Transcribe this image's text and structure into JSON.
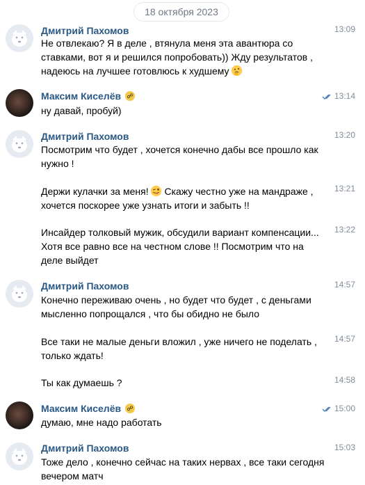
{
  "date_label": "18 октября 2023",
  "messages": [
    {
      "author": "Дмитрий Пахомов",
      "time": "13:09",
      "text": "Не отвлекаю? Я в деле , втянула меня эта авантюра со ставками, вот я и решился попробовать)) Жду результатов , надеюсь на лучшее готовлюсь к худшему",
      "emoji": "thinking-face"
    },
    {
      "author": "Максим Киселёв",
      "time": "13:14",
      "text": "ну давай, пробуй)",
      "read": true
    },
    {
      "author": "Дмитрий Пахомов",
      "time": "13:20",
      "text": "Посмотрим что будет , хочется конечно дабы все прошло как нужно !"
    },
    {
      "time": "13:21",
      "text_a": "Держи кулачки за меня!",
      "text_b": " Скажу честно уже на мандраже , хочется поскорее уже узнать итоги и забыть !!",
      "emoji": "winking-face-with-tongue"
    },
    {
      "time": "13:22",
      "text": "Инсайдер толковый мужик, обсудили вариант компенсации... Хотя все равно все на честном слове !! Посмотрим что на деле выйдет"
    },
    {
      "author": "Дмитрий Пахомов",
      "time": "14:57",
      "text": "Конечно переживаю очень , но будет что будет , с деньгами мысленно попрощался , что бы обидно не было"
    },
    {
      "time": "14:57",
      "text": "Все таки не малые деньги вложил , уже ничего не поделать , только ждать!"
    },
    {
      "time": "14:58",
      "text": "Ты как думаешь ?"
    },
    {
      "author": "Максим Киселёв",
      "time": "15:00",
      "text": "думаю, мне надо работать",
      "read": true
    },
    {
      "author": "Дмитрий Пахомов",
      "time": "15:03",
      "text": "Тоже дело , конечно сейчас на таких нервах , все таки сегодня вечером матч"
    }
  ],
  "colors": {
    "author": "#2a5885",
    "time": "#818c99",
    "read_check": "#5181b8"
  }
}
